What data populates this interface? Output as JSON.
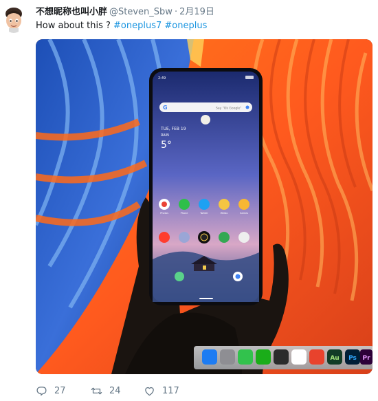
{
  "tweet": {
    "display_name": "不想昵称也叫小胖",
    "handle": "@Steven_Sbw",
    "separator": "·",
    "timestamp": "2月19日",
    "text_prefix": "How about this ? ",
    "hashtags": [
      "#oneplus7",
      "#oneplus"
    ]
  },
  "phone_screen": {
    "status_time": "2:49",
    "search_placeholder": "Say \"Ok Google\"",
    "date": "TUE, FEB 19",
    "weather": "RAIN",
    "temperature": "5°",
    "app_labels": [
      "Photos",
      "Phone",
      "Twitter",
      "Weibo",
      "Games"
    ]
  },
  "actions": {
    "reply_count": "27",
    "retweet_count": "24",
    "like_count": "117"
  },
  "colors": {
    "hashtag": "#1b95e0",
    "secondary_text": "#657786",
    "primary_text": "#14171a"
  },
  "icons": [
    "reply-icon",
    "retweet-icon",
    "heart-icon"
  ]
}
